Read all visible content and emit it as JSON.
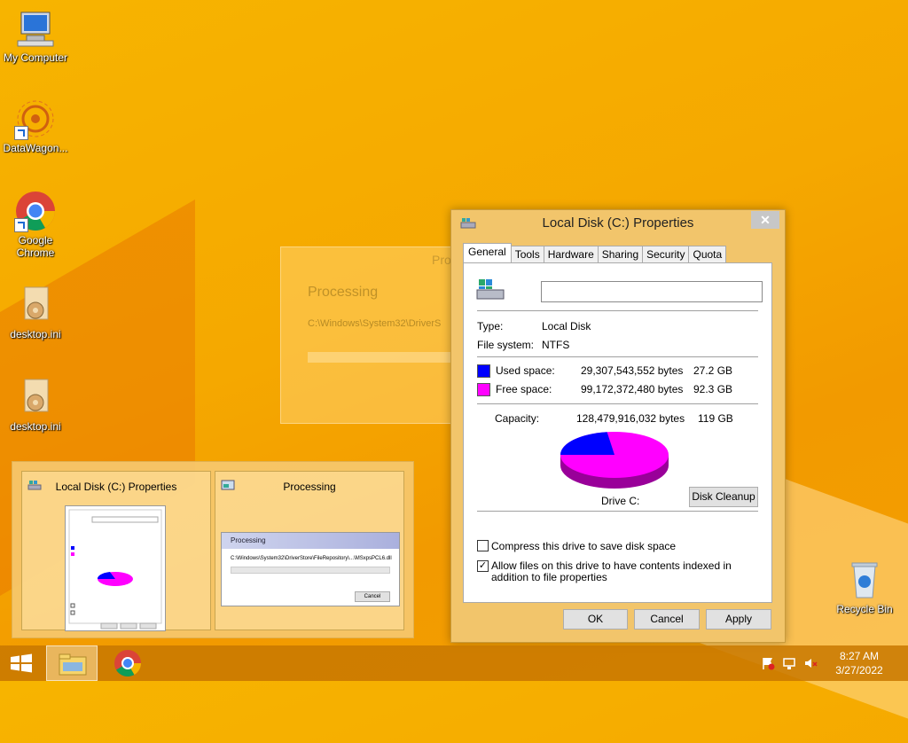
{
  "desktop": {
    "icons": [
      {
        "label": "My Computer",
        "icon": "computer-icon"
      },
      {
        "label": "DataWagon...",
        "icon": "datawagon-icon"
      },
      {
        "label": "Google Chrome",
        "icon": "chrome-icon"
      },
      {
        "label": "desktop.ini",
        "icon": "settings-file-icon"
      },
      {
        "label": "desktop.ini",
        "icon": "settings-file-icon"
      },
      {
        "label": "Recycle Bin",
        "icon": "recycle-bin-icon"
      }
    ]
  },
  "ghost_window": {
    "title": "Pro",
    "heading": "Processing",
    "path": "C:\\Windows\\System32\\DriverS"
  },
  "properties": {
    "title": "Local Disk (C:) Properties",
    "close": "✕",
    "tabs": [
      "General",
      "Tools",
      "Hardware",
      "Sharing",
      "Security",
      "Quota"
    ],
    "name_value": "",
    "type_label": "Type:",
    "type_value": "Local Disk",
    "fs_label": "File system:",
    "fs_value": "NTFS",
    "used_label": "Used space:",
    "used_bytes": "29,307,543,552 bytes",
    "used_gb": "27.2 GB",
    "free_label": "Free space:",
    "free_bytes": "99,172,372,480 bytes",
    "free_gb": "92.3 GB",
    "capacity_label": "Capacity:",
    "capacity_bytes": "128,479,916,032 bytes",
    "capacity_gb": "119 GB",
    "drive_label": "Drive C:",
    "cleanup_button": "Disk Cleanup",
    "compress_label": "Compress this drive to save disk space",
    "index_label": "Allow files on this drive to have contents indexed in addition to file properties",
    "ok": "OK",
    "cancel": "Cancel",
    "apply": "Apply",
    "used_color": "#0000ff",
    "free_color": "#ff00ff",
    "used_fraction": 0.228
  },
  "preview": {
    "thumb1_title": "Local Disk (C:) Properties",
    "thumb2_title": "Processing",
    "mini_processing": "Processing",
    "mini_path": "C:\\Windows\\System32\\DriverStore\\FileRepository\\...\\MSxpsPCL6.dll",
    "mini_cancel": "Cancel"
  },
  "taskbar": {
    "time": "8:27 AM",
    "date": "3/27/2022"
  }
}
